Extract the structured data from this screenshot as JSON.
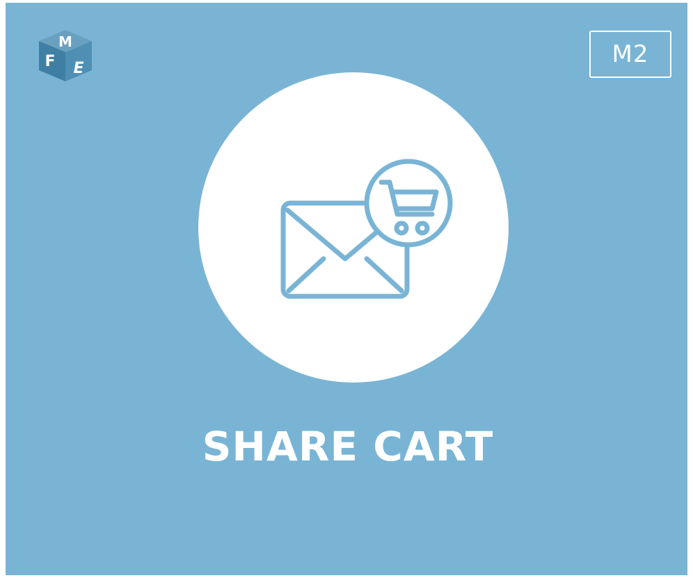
{
  "brand": {
    "logo_letters": "FME",
    "logo_icon": "fme-cube-logo"
  },
  "badge": {
    "label": "M2"
  },
  "hero": {
    "icon": "envelope-cart-icon",
    "title": "SHARE CART"
  },
  "colors": {
    "background": "#79b4d5",
    "circle": "#ffffff",
    "icon_stroke": "#79b4d5",
    "text": "#ffffff"
  }
}
